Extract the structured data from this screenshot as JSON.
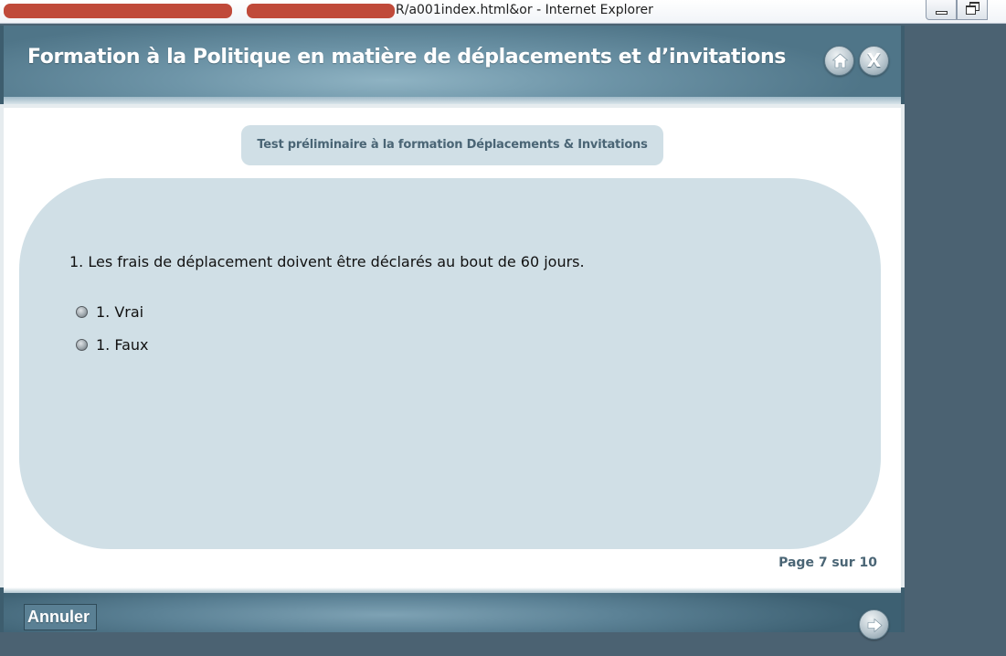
{
  "browser": {
    "title": "R/a001index.html&or - Internet Explorer",
    "minimize_icon": "minimize-icon",
    "restore_icon": "restore-icon"
  },
  "course": {
    "title": "Formation à la Politique en matière de déplacements et d’invitations",
    "home_icon": "home-icon",
    "close_label": "X"
  },
  "content": {
    "test_title": "Test préliminaire à la formation Déplacements & Invitations",
    "question": "1. Les frais de déplacement doivent être déclarés au bout de 60 jours.",
    "options": [
      {
        "label": "1. Vrai",
        "selected": false
      },
      {
        "label": "1. Faux",
        "selected": false
      }
    ],
    "page_counter": "Page 7 sur 10"
  },
  "footer": {
    "cancel_label": "Annuler",
    "next_icon": "arrow-right-icon"
  },
  "colors": {
    "header_blue": "#6e95a8",
    "panel_blue": "#d0dfe6",
    "desktop": "#4b6272",
    "redaction": "#c04a3a"
  }
}
